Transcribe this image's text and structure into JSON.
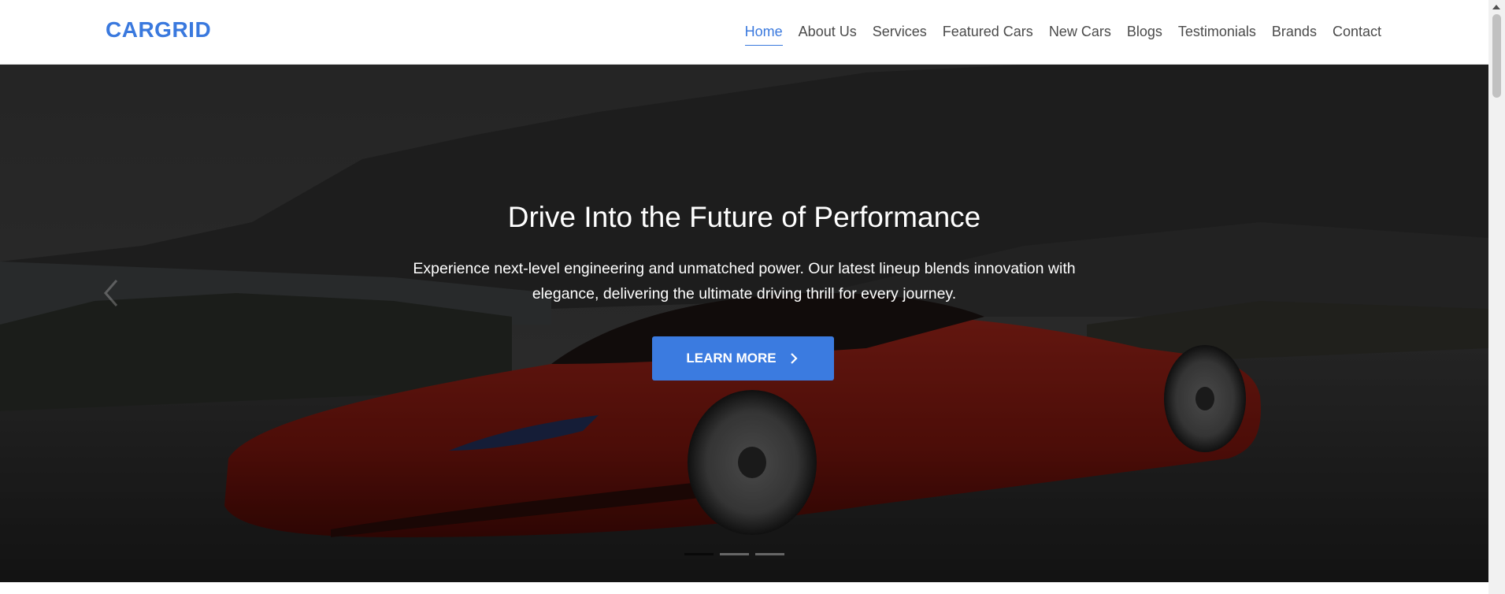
{
  "brand": "CARGRID",
  "nav": {
    "items": [
      {
        "label": "Home",
        "active": true
      },
      {
        "label": "About Us"
      },
      {
        "label": "Services"
      },
      {
        "label": "Featured Cars"
      },
      {
        "label": "New Cars"
      },
      {
        "label": "Blogs"
      },
      {
        "label": "Testimonials"
      },
      {
        "label": "Brands"
      },
      {
        "label": "Contact"
      }
    ]
  },
  "hero": {
    "title": "Drive Into the Future of Performance",
    "text": "Experience next-level engineering and unmatched power. Our latest lineup blends innovation with elegance, delivering the ultimate driving thrill for every journey.",
    "button_label": "LEARN MORE",
    "slides_total": 3,
    "active_slide": 1
  },
  "colors": {
    "accent": "#3a79de",
    "car_red": "#8b1a12",
    "nav_text": "#4a4a4a"
  }
}
